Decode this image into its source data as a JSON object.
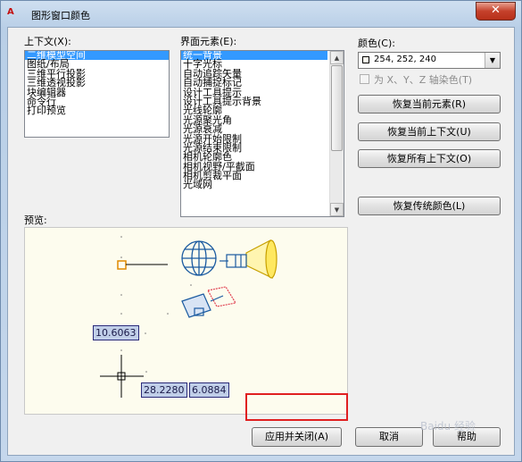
{
  "window": {
    "title": "图形窗口颜色",
    "icon_text": "A",
    "close_glyph": "✕"
  },
  "context": {
    "label": "上下文(X):",
    "items": [
      "二维模型空间",
      "图纸/布局",
      "三维平行投影",
      "三维透视投影",
      "块编辑器",
      "命令行",
      "打印预览"
    ],
    "selected_index": 0
  },
  "elements": {
    "label": "界面元素(E):",
    "items": [
      "统一背景",
      "十字光标",
      "自动追踪矢量",
      "自动捕捉标记",
      "设计工具提示",
      "设计工具提示背景",
      "光线轮廓",
      "光源聚光角",
      "光源衰减",
      "光源开始限制",
      "光源结束限制",
      "相机轮廓色",
      "相机视野/平截面",
      "相机剪裁平面",
      "光域网"
    ],
    "selected_index": 0
  },
  "color": {
    "label": "颜色(C):",
    "value": "254, 252, 240",
    "swatch": "#fefcf0",
    "tint_checkbox_label": "为 X、Y、Z 轴染色(T)",
    "tint_checked": false
  },
  "buttons": {
    "restore_element": "恢复当前元素(R)",
    "restore_context": "恢复当前上下文(U)",
    "restore_all": "恢复所有上下文(O)",
    "restore_classic": "恢复传统颜色(L)",
    "apply_close": "应用并关闭(A)",
    "cancel": "取消",
    "help": "帮助"
  },
  "preview": {
    "label": "预览:",
    "dim_top": "10.6063",
    "dim_x": "28.2280",
    "dim_y": "6.0884"
  },
  "colors": {
    "accent": "#3399ff",
    "highlight": "#e02020",
    "preview_bg": "#fdfcee"
  },
  "watermark": "Baidu 经验"
}
